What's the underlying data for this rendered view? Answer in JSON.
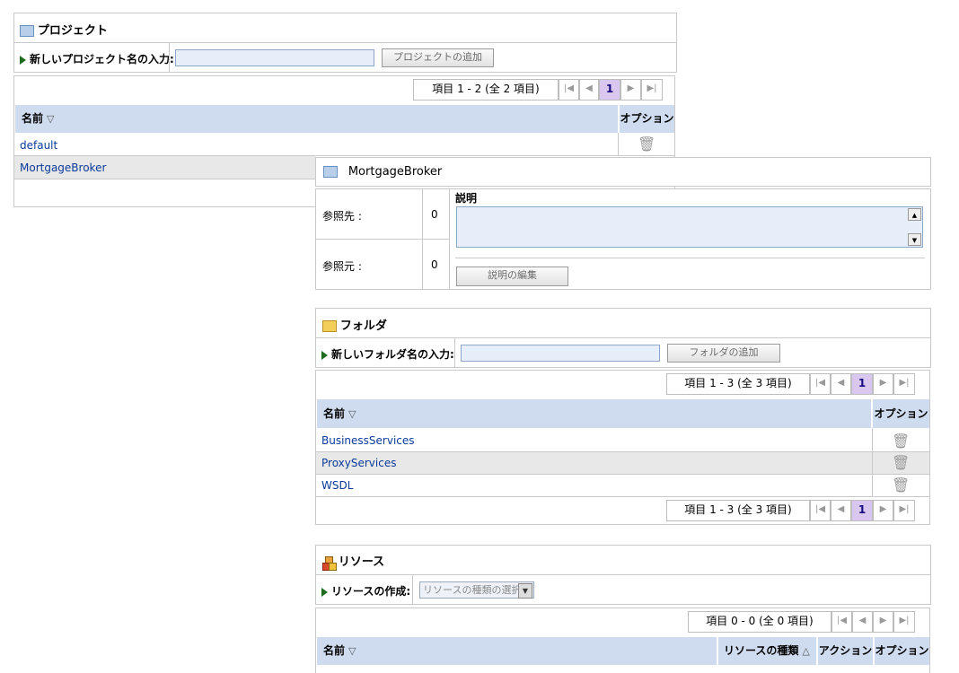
{
  "project_panel": {
    "title": "プロジェクト",
    "new_label": "新しいプロジェクト名の入力:",
    "new_value": "",
    "add_button": "プロジェクトの追加",
    "pager_info": "項目 1 - 2 (全 2 項目)",
    "page": "1",
    "col_name": "名前",
    "col_options": "オプション",
    "rows": [
      "default",
      "MortgageBroker"
    ]
  },
  "detail_panel": {
    "title": "MortgageBroker",
    "ref_to_label": "参照先 :",
    "ref_to_value": "0",
    "ref_from_label": "参照元 :",
    "ref_from_value": "0",
    "desc_label": "説明",
    "desc_value": "",
    "edit_button": "説明の編集"
  },
  "folder_panel": {
    "title": "フォルダ",
    "new_label": "新しいフォルダ名の入力:",
    "new_value": "",
    "add_button": "フォルダの追加",
    "pager_info": "項目 1 - 3 (全 3 項目)",
    "page": "1",
    "col_name": "名前",
    "col_options": "オプション",
    "rows": [
      "BusinessServices",
      "ProxyServices",
      "WSDL"
    ],
    "pager_info_bottom": "項目 1 - 3 (全 3 項目)",
    "page_bottom": "1"
  },
  "resource_panel": {
    "title": "リソース",
    "create_label": "リソースの作成:",
    "select_value": "リソースの種類の選択",
    "pager_info": "項目 0 - 0 (全 0 項目)",
    "col_name": "名前",
    "col_type": "リソースの種類",
    "col_action": "アクション",
    "col_options": "オプション"
  },
  "icons": {
    "first": "first-page-icon",
    "prev": "prev-page-icon",
    "next": "next-page-icon",
    "last": "last-page-icon",
    "delete": "trash-icon"
  }
}
